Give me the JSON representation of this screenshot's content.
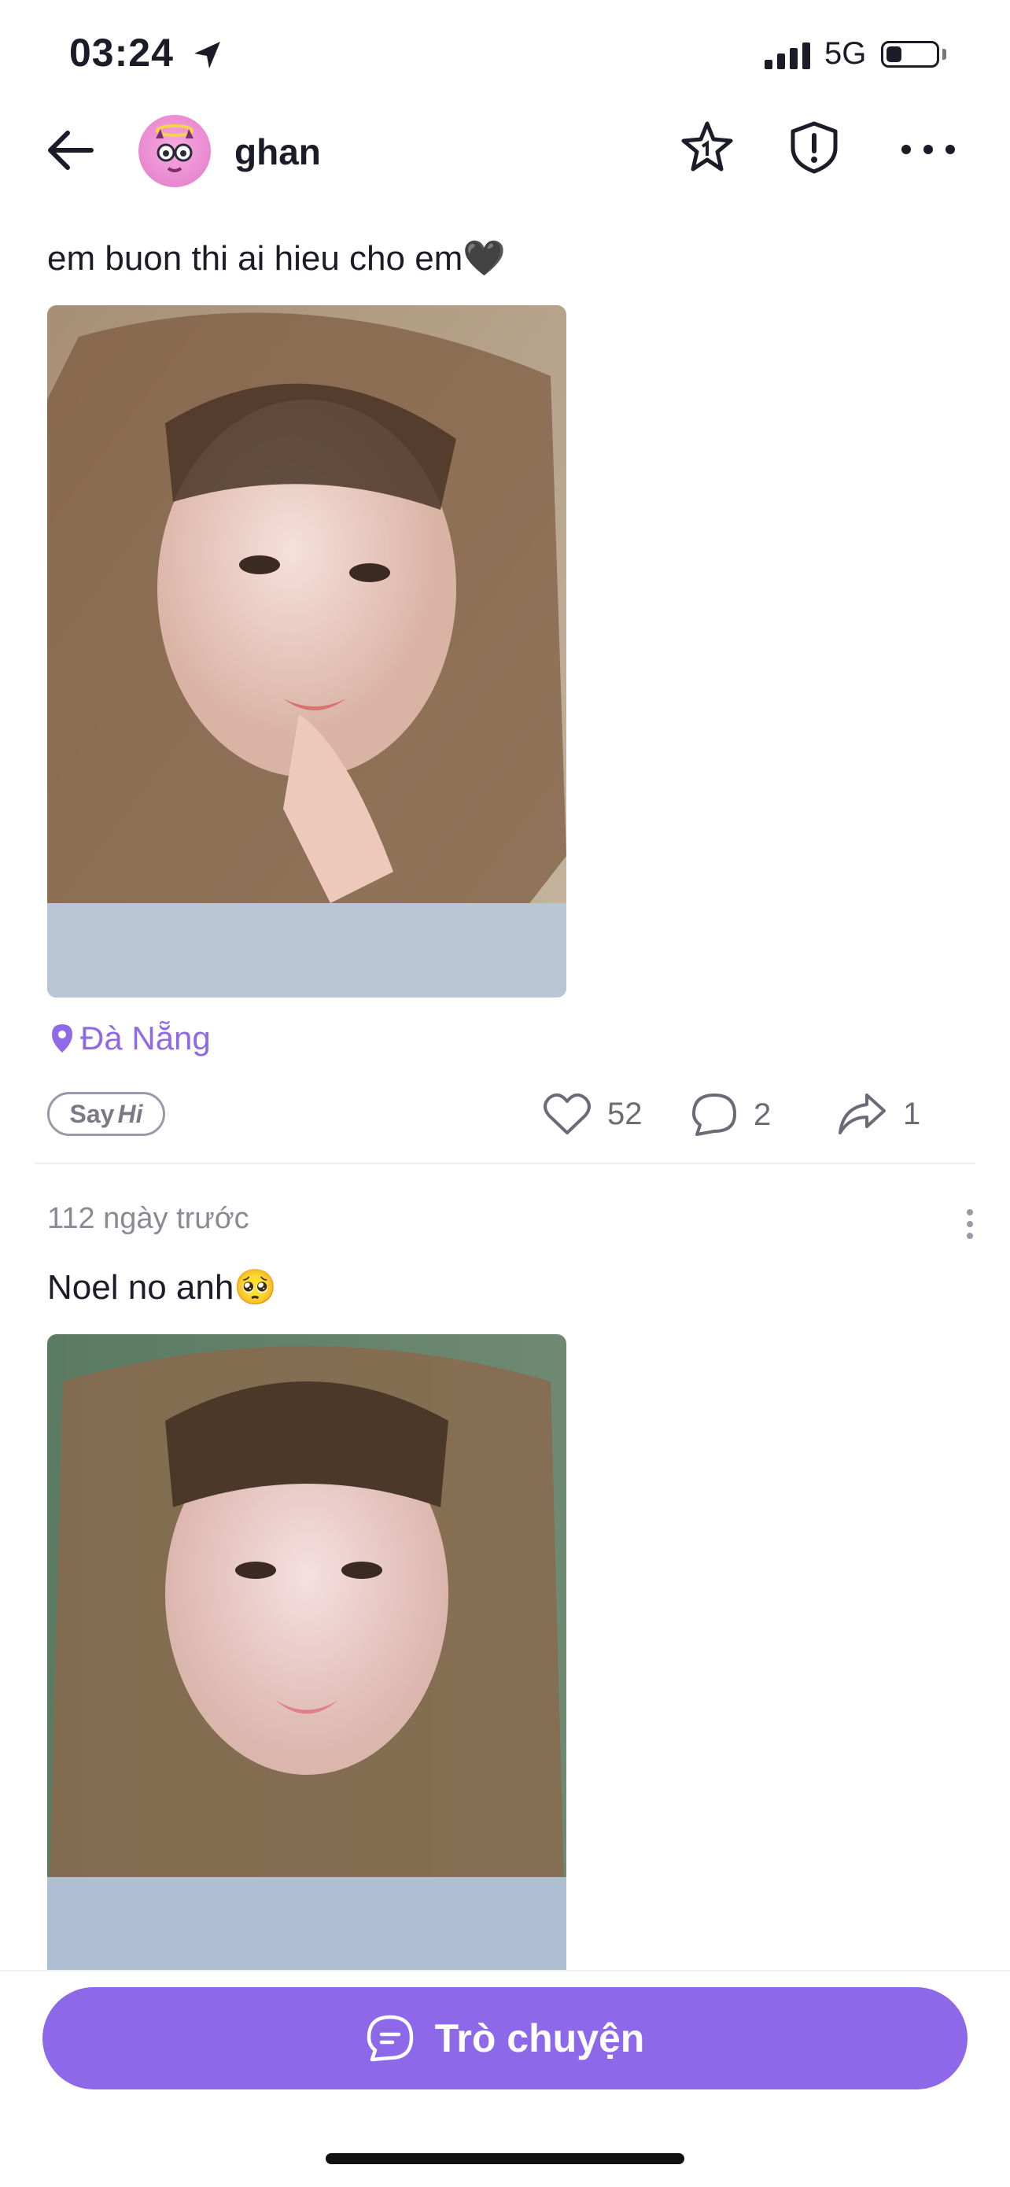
{
  "status_bar": {
    "time": "03:24",
    "network": "5G",
    "battery_level": 0.3
  },
  "header": {
    "username": "ghan"
  },
  "posts": [
    {
      "caption": "em buon thi ai hieu cho em🖤",
      "location": "Đà Nẵng",
      "say_hi_prefix": "Say",
      "say_hi_suffix": "Hi",
      "likes": "52",
      "comments": "2",
      "shares": "1"
    },
    {
      "time_ago": "112 ngày trước",
      "caption": "Noel no anh🥺"
    }
  ],
  "chat_button": {
    "label": "Trò chuyện"
  },
  "colors": {
    "accent": "#8d68e8",
    "location": "#8e6ae6"
  },
  "icons": [
    "location-arrow-icon",
    "signal-icon",
    "battery-icon",
    "back-arrow-icon",
    "star-badge-icon",
    "shield-alert-icon",
    "more-icon",
    "pin-icon",
    "heart-icon",
    "comment-icon",
    "share-icon",
    "chat-icon"
  ]
}
